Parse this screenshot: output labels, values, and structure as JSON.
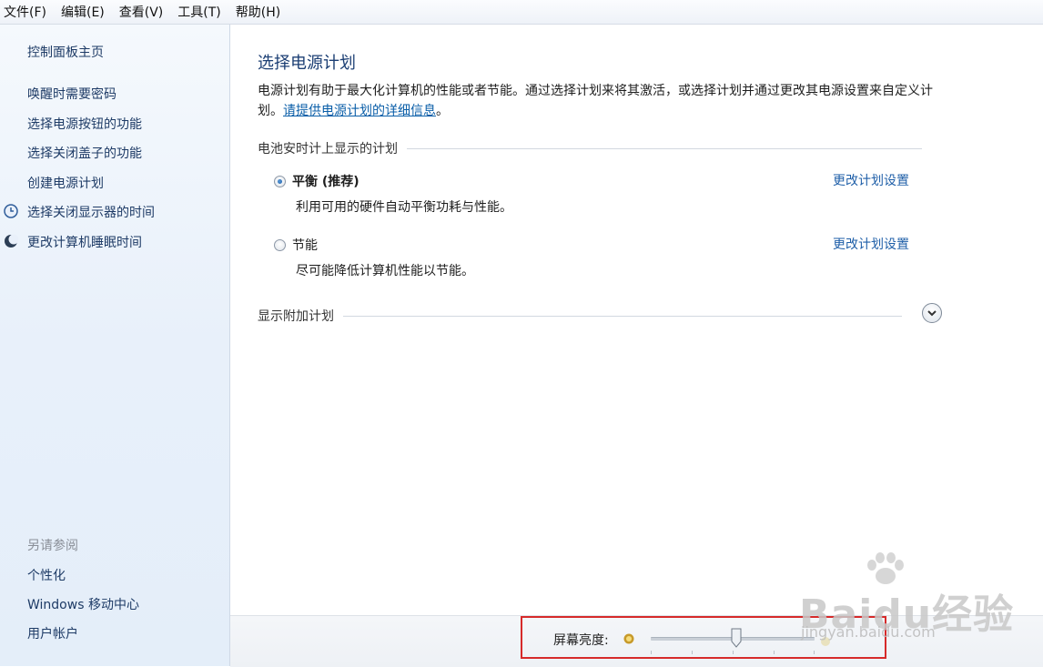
{
  "menubar": {
    "items": [
      {
        "label": "文件(F)"
      },
      {
        "label": "编辑(E)"
      },
      {
        "label": "查看(V)"
      },
      {
        "label": "工具(T)"
      },
      {
        "label": "帮助(H)"
      }
    ]
  },
  "sidebar": {
    "home": "控制面板主页",
    "links": [
      {
        "label": "唤醒时需要密码"
      },
      {
        "label": "选择电源按钮的功能"
      },
      {
        "label": "选择关闭盖子的功能"
      },
      {
        "label": "创建电源计划"
      },
      {
        "label": "选择关闭显示器的时间",
        "icon": "clock-icon"
      },
      {
        "label": "更改计算机睡眠时间",
        "icon": "moon-icon"
      }
    ],
    "see_also": {
      "title": "另请参阅",
      "links": [
        {
          "label": "个性化"
        },
        {
          "label": "Windows 移动中心"
        },
        {
          "label": "用户帐户"
        }
      ]
    }
  },
  "main": {
    "title": "选择电源计划",
    "description": "电源计划有助于最大化计算机的性能或者节能。通过选择计划来将其激活，或选择计划并通过更改其电源设置来自定义计划。",
    "description_link": "请提供电源计划的详细信息",
    "description_end": "。",
    "battery_section": "电池安时计上显示的计划",
    "plans": [
      {
        "name": "平衡 (推荐)",
        "description": "利用可用的硬件自动平衡功耗与性能。",
        "selected": true,
        "change_link": "更改计划设置"
      },
      {
        "name": "节能",
        "description": "尽可能降低计算机性能以节能。",
        "selected": false,
        "change_link": "更改计划设置"
      }
    ],
    "show_additional": "显示附加计划"
  },
  "bottom": {
    "brightness_label": "屏幕亮度:",
    "brightness_level": 0.52,
    "highlight_color": "#d62a2a"
  },
  "watermark": {
    "logo": "Baidu经验",
    "url": "jingyan.baidu.com"
  },
  "colors": {
    "link": "#1f5fa8",
    "title": "#1c3f74"
  }
}
